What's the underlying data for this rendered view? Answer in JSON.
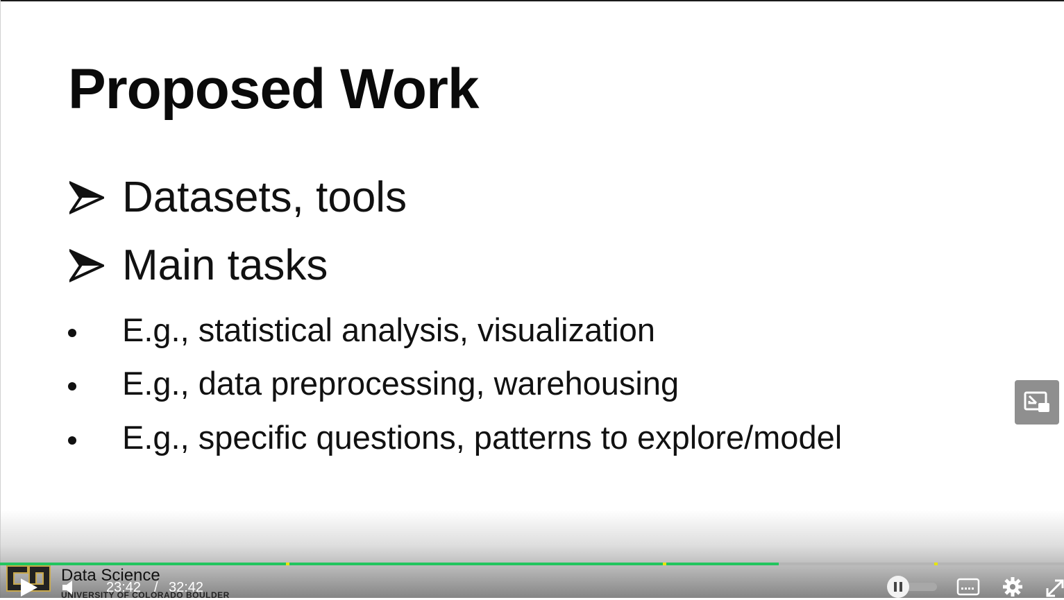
{
  "slide": {
    "title": "Proposed Work",
    "arrow_items": [
      "Datasets, tools",
      "Main tasks"
    ],
    "bullet_items": [
      "E.g., statistical analysis, visualization",
      "E.g., data preprocessing, warehousing",
      "E.g., specific questions, patterns to explore/model"
    ]
  },
  "branding": {
    "name": "Data Science",
    "subtitle": "UNIVERSITY OF COLORADO BOULDER"
  },
  "player": {
    "current_time": "23:42",
    "separator": "/",
    "duration": "32:42",
    "progress_fraction": 0.732,
    "chapter_markers": [
      0.27,
      0.624,
      0.879
    ],
    "colors": {
      "progress": "#22c55e",
      "marker": "#e6e600",
      "track": "#b5b5b5"
    },
    "icons": {
      "play": "play-icon",
      "volume": "volume-icon",
      "pause": "pause-icon",
      "captions": "captions-icon",
      "settings": "gear-icon",
      "fullscreen": "fullscreen-icon",
      "pip": "picture-in-picture-icon"
    }
  }
}
